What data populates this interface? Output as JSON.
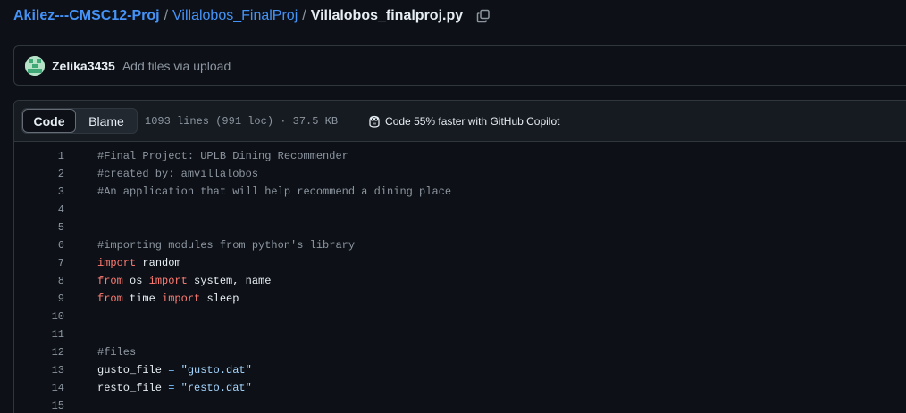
{
  "breadcrumb": {
    "repo": "Akilez---CMSC12-Proj",
    "separator": "/",
    "folder": "Villalobos_FinalProj",
    "file": "Villalobos_finalproj.py"
  },
  "commit": {
    "author": "Zelika3435",
    "message": "Add files via upload"
  },
  "file_header": {
    "tabs": [
      "Code",
      "Blame"
    ],
    "active_tab": "Code",
    "meta": "1093 lines (991 loc) · 37.5 KB",
    "copilot_text": "Code 55% faster with GitHub Copilot"
  },
  "code": {
    "line_numbers": [
      "1",
      "2",
      "3",
      "4",
      "5",
      "6",
      "7",
      "8",
      "9",
      "10",
      "11",
      "12",
      "13",
      "14",
      "15"
    ],
    "tokens": {
      "l1": "#Final Project: UPLB Dining Recommender",
      "l2": "#created by: amvillalobos",
      "l3": "#An application that will help recommend a dining place",
      "l6": "#importing modules from python's library",
      "l7_kw": "import",
      "l7_rest": " random",
      "l8_kw1": "from",
      "l8_mid": " os ",
      "l8_kw2": "import",
      "l8_rest": " system, name",
      "l9_kw1": "from",
      "l9_mid": " time ",
      "l9_kw2": "import",
      "l9_rest": " sleep",
      "l12": "#files",
      "l13_var": "gusto_file ",
      "l13_op": "=",
      "l13_str": " \"gusto.dat\"",
      "l14_var": "resto_file ",
      "l14_op": "=",
      "l14_str": " \"resto.dat\""
    }
  },
  "colors": {
    "background": "#0d1117",
    "link": "#4493f8",
    "keyword": "#ff7b72",
    "string": "#a5d6ff",
    "comment": "#8d96a0"
  },
  "icons": [
    "copy-icon",
    "avatar",
    "copilot-icon"
  ]
}
